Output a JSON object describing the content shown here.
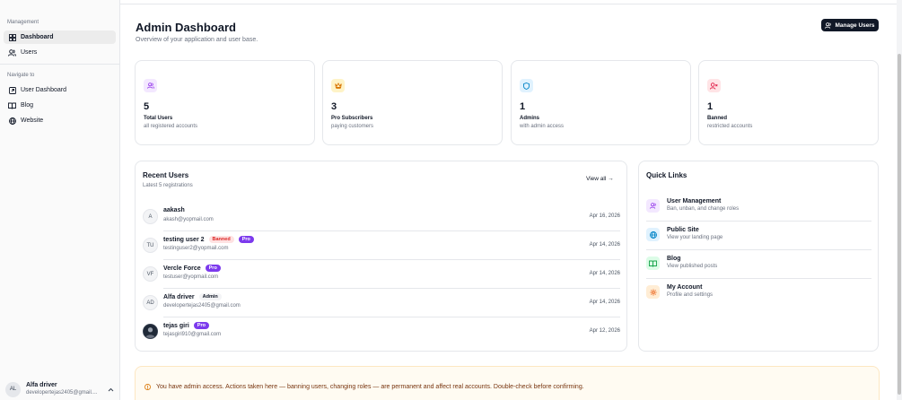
{
  "sidebar": {
    "section_management": "Management",
    "items_management": [
      {
        "label": "Dashboard",
        "icon": "grid-icon",
        "active": true
      },
      {
        "label": "Users",
        "icon": "users-icon",
        "active": false
      }
    ],
    "section_navigate": "Navigate to",
    "items_navigate": [
      {
        "label": "User Dashboard",
        "icon": "external-square-icon"
      },
      {
        "label": "Blog",
        "icon": "book-icon"
      },
      {
        "label": "Website",
        "icon": "globe-icon"
      }
    ],
    "footer": {
      "initials": "AL",
      "name": "Alfa driver",
      "email": "developertejas2405@gmail...."
    }
  },
  "header": {
    "title": "Admin Dashboard",
    "subtitle": "Overview of your application and user base.",
    "manage_button": "Manage Users"
  },
  "stats": [
    {
      "value": "5",
      "label": "Total Users",
      "desc": "all registered accounts",
      "icon": "users-icon",
      "bg": "#f3e8ff",
      "fg": "#9333ea"
    },
    {
      "value": "3",
      "label": "Pro Subscribers",
      "desc": "paying customers",
      "icon": "crown-icon",
      "bg": "#fef3c7",
      "fg": "#d97706"
    },
    {
      "value": "1",
      "label": "Admins",
      "desc": "with admin access",
      "icon": "shield-icon",
      "bg": "#e0f2fe",
      "fg": "#0284c7"
    },
    {
      "value": "1",
      "label": "Banned",
      "desc": "restricted accounts",
      "icon": "user-x-icon",
      "bg": "#ffe4e6",
      "fg": "#e11d48"
    }
  ],
  "recent": {
    "title": "Recent Users",
    "subtitle": "Latest 5 registrations",
    "view_all": "View all →",
    "users": [
      {
        "initials": "A",
        "name": "aakash",
        "email": "akash@yopmail.com",
        "date": "Apr 16, 2026",
        "tags": []
      },
      {
        "initials": "TU",
        "name": "testing user 2",
        "email": "testinguser2@yopmail.com",
        "date": "Apr 14, 2026",
        "tags": [
          "Banned",
          "Pro"
        ]
      },
      {
        "initials": "VF",
        "name": "Vercle Force",
        "email": "testuser@yopmail.com",
        "date": "Apr 14, 2026",
        "tags": [
          "Pro"
        ]
      },
      {
        "initials": "AD",
        "name": "Alfa driver",
        "email": "developertejas2405@gmail.com",
        "date": "Apr 14, 2026",
        "tags": [
          "Admin"
        ]
      },
      {
        "initials": "",
        "name": "tejas giri",
        "email": "tejasgiri910@gmail.com",
        "date": "Apr 12, 2026",
        "tags": [
          "Pro"
        ],
        "photo": true
      }
    ]
  },
  "quick_links": {
    "title": "Quick Links",
    "items": [
      {
        "title": "User Management",
        "desc": "Ban, unban, and change roles",
        "icon": "users-icon",
        "bg": "#f3e8ff",
        "fg": "#9333ea"
      },
      {
        "title": "Public Site",
        "desc": "View your landing page",
        "icon": "globe-icon",
        "bg": "#e0f2fe",
        "fg": "#0284c7"
      },
      {
        "title": "Blog",
        "desc": "View published posts",
        "icon": "book-icon",
        "bg": "#dcfce7",
        "fg": "#16a34a"
      },
      {
        "title": "My Account",
        "desc": "Profile and settings",
        "icon": "gear-icon",
        "bg": "#ffedd5",
        "fg": "#ea580c"
      }
    ]
  },
  "alert": {
    "text": "You have admin access. Actions taken here — banning users, changing roles — are permanent and affect real accounts. Double-check before confirming."
  }
}
